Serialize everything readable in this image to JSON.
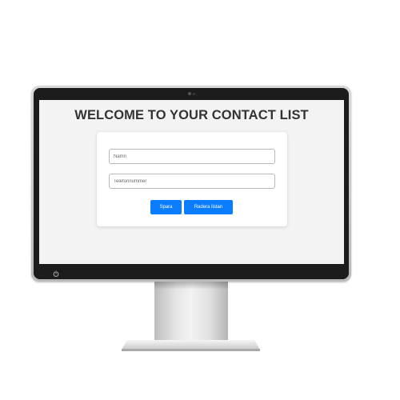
{
  "page": {
    "title": "WELCOME TO YOUR CONTACT LIST"
  },
  "form": {
    "name_field": {
      "value": "",
      "placeholder": "Namn"
    },
    "phone_field": {
      "value": "",
      "placeholder": "Telefonnummer"
    },
    "save_label": "Spara",
    "clear_label": "Radera listan"
  },
  "colors": {
    "screen_background": "#f3f3f3",
    "button_primary": "#0a7cff",
    "title_text": "#333333",
    "bezel": "#1c1c1c"
  },
  "icons": {
    "power": "power-icon",
    "camera": "camera-icon"
  }
}
